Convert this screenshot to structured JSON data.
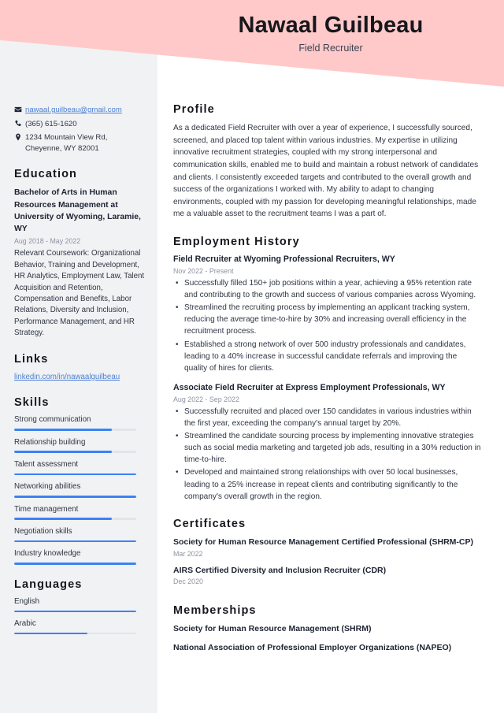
{
  "header": {
    "name": "Nawaal Guilbeau",
    "job_title": "Field Recruiter",
    "band_color": "#ffc9c9"
  },
  "theme": {
    "accent_blue": "#3b82f6",
    "sidebar_gray": "#f1f2f4",
    "link_blue": "#4a7fd4",
    "text_dark": "#2f3542",
    "muted_gray": "#8d93a1"
  },
  "sidebar": {
    "contact": [
      {
        "icon": "envelope-icon",
        "text": "nawaal.guilbeau@gmail.com",
        "is_link": true
      },
      {
        "icon": "phone-icon",
        "text": "(365) 615-1620",
        "is_link": false
      },
      {
        "icon": "location-pin-icon",
        "text": "1234 Mountain View Rd,\nCheyenne, WY 82001",
        "is_link": false
      }
    ],
    "education": {
      "heading": "Education",
      "degree": "Bachelor of Arts in Human Resources Management at University of Wyoming, Laramie, WY",
      "dates": "Aug 2018 - May 2022",
      "coursework": "Relevant Coursework: Organizational Behavior, Training and Development, HR Analytics, Employment Law, Talent Acquisition and Retention, Compensation and Benefits, Labor Relations, Diversity and Inclusion, Performance Management, and HR Strategy."
    },
    "links": {
      "heading": "Links",
      "items": [
        {
          "label": "linkedin.com/in/nawaalguilbeau"
        }
      ]
    },
    "skills": {
      "heading": "Skills",
      "items": [
        {
          "label": "Strong communication",
          "level": 80
        },
        {
          "label": "Relationship building",
          "level": 80
        },
        {
          "label": "Talent assessment",
          "level": 100
        },
        {
          "label": "Networking abilities",
          "level": 100
        },
        {
          "label": "Time management",
          "level": 80
        },
        {
          "label": "Negotiation skills",
          "level": 100
        },
        {
          "label": "Industry knowledge",
          "level": 100
        }
      ]
    },
    "languages": {
      "heading": "Languages",
      "items": [
        {
          "label": "English",
          "level": 100
        },
        {
          "label": "Arabic",
          "level": 60
        }
      ]
    }
  },
  "main": {
    "profile": {
      "heading": "Profile",
      "text": "As a dedicated Field Recruiter with over a year of experience, I successfully sourced, screened, and placed top talent within various industries. My expertise in utilizing innovative recruitment strategies, coupled with my strong interpersonal and communication skills, enabled me to build and maintain a robust network of candidates and clients. I consistently exceeded targets and contributed to the overall growth and success of the organizations I worked with. My ability to adapt to changing environments, coupled with my passion for developing meaningful relationships, made me a valuable asset to the recruitment teams I was a part of."
    },
    "employment": {
      "heading": "Employment History",
      "jobs": [
        {
          "role": "Field Recruiter at Wyoming Professional Recruiters, WY",
          "dates": "Nov 2022 - Present",
          "bullets": [
            "Successfully filled 150+ job positions within a year, achieving a 95% retention rate and contributing to the growth and success of various companies across Wyoming.",
            "Streamlined the recruiting process by implementing an applicant tracking system, reducing the average time-to-hire by 30% and increasing overall efficiency in the recruitment process.",
            "Established a strong network of over 500 industry professionals and candidates, leading to a 40% increase in successful candidate referrals and improving the quality of hires for clients."
          ]
        },
        {
          "role": "Associate Field Recruiter at Express Employment Professionals, WY",
          "dates": "Aug 2022 - Sep 2022",
          "bullets": [
            "Successfully recruited and placed over 150 candidates in various industries within the first year, exceeding the company's annual target by 20%.",
            "Streamlined the candidate sourcing process by implementing innovative strategies such as social media marketing and targeted job ads, resulting in a 30% reduction in time-to-hire.",
            "Developed and maintained strong relationships with over 50 local businesses, leading to a 25% increase in repeat clients and contributing significantly to the company's overall growth in the region."
          ]
        }
      ]
    },
    "certificates": {
      "heading": "Certificates",
      "items": [
        {
          "name": "Society for Human Resource Management Certified Professional (SHRM-CP)",
          "date": "Mar 2022"
        },
        {
          "name": "AIRS Certified Diversity and Inclusion Recruiter (CDR)",
          "date": "Dec 2020"
        }
      ]
    },
    "memberships": {
      "heading": "Memberships",
      "items": [
        {
          "name": "Society for Human Resource Management (SHRM)"
        },
        {
          "name": "National Association of Professional Employer Organizations (NAPEO)"
        }
      ]
    }
  }
}
